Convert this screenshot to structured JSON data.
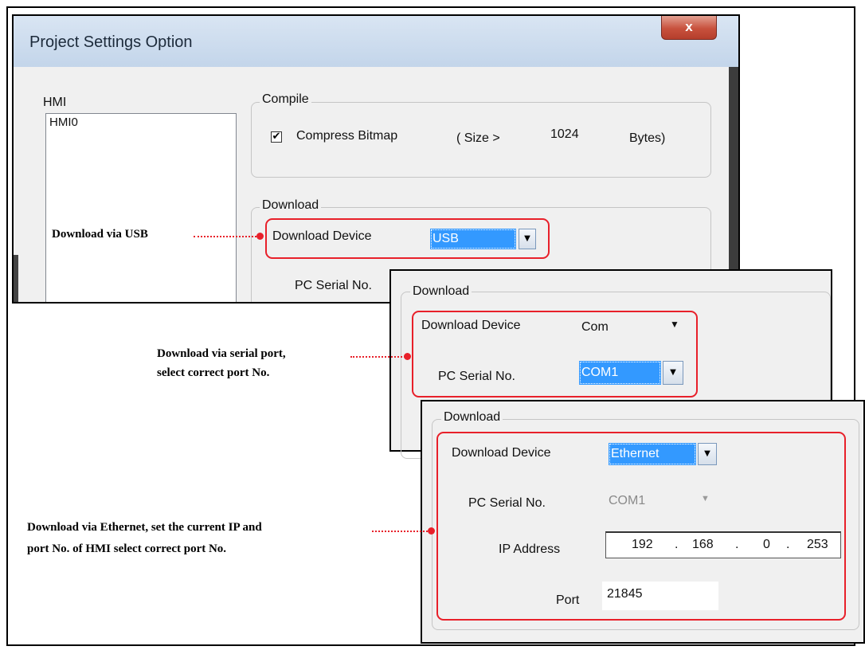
{
  "dialog": {
    "title": "Project Settings Option",
    "close_label": "x",
    "hmi_label": "HMI",
    "hmi_items": [
      "HMI0"
    ],
    "compile": {
      "group_title": "Compile",
      "compress_label": "Compress Bitmap",
      "compress_checked": true,
      "size_prefix": "( Size >",
      "size_value": "1024",
      "size_suffix": "Bytes)"
    },
    "download": {
      "group_title": "Download",
      "device_label": "Download Device",
      "device_value": "USB",
      "serial_label_partial": "PC Serial No."
    }
  },
  "serial_panel": {
    "group_title": "Download",
    "device_label": "Download Device",
    "device_value": "Com",
    "serial_label": "PC Serial No.",
    "serial_value": "COM1"
  },
  "ethernet_panel": {
    "group_title": "Download",
    "device_label": "Download Device",
    "device_value": "Ethernet",
    "serial_label": "PC Serial No.",
    "serial_value": "COM1",
    "ip_label": "IP Address",
    "ip_octets": [
      "192",
      "168",
      "0",
      "253"
    ],
    "ip_separator": ".",
    "port_label": "Port",
    "port_value": "21845"
  },
  "annotations": {
    "usb": "Download via USB",
    "serial_line1": "Download via serial port,",
    "serial_line2": "select correct port No.",
    "ethernet_line1": "Download via Ethernet, set the current IP and",
    "ethernet_line2": " port No. of HMI select correct port No."
  },
  "colors": {
    "highlight_red": "#e8202a",
    "selection_blue": "#3399ff",
    "dialog_bg": "#f0f0f0"
  },
  "icons": {
    "close": "close-icon",
    "dropdown": "chevron-down-icon",
    "check": "checkmark-icon"
  }
}
